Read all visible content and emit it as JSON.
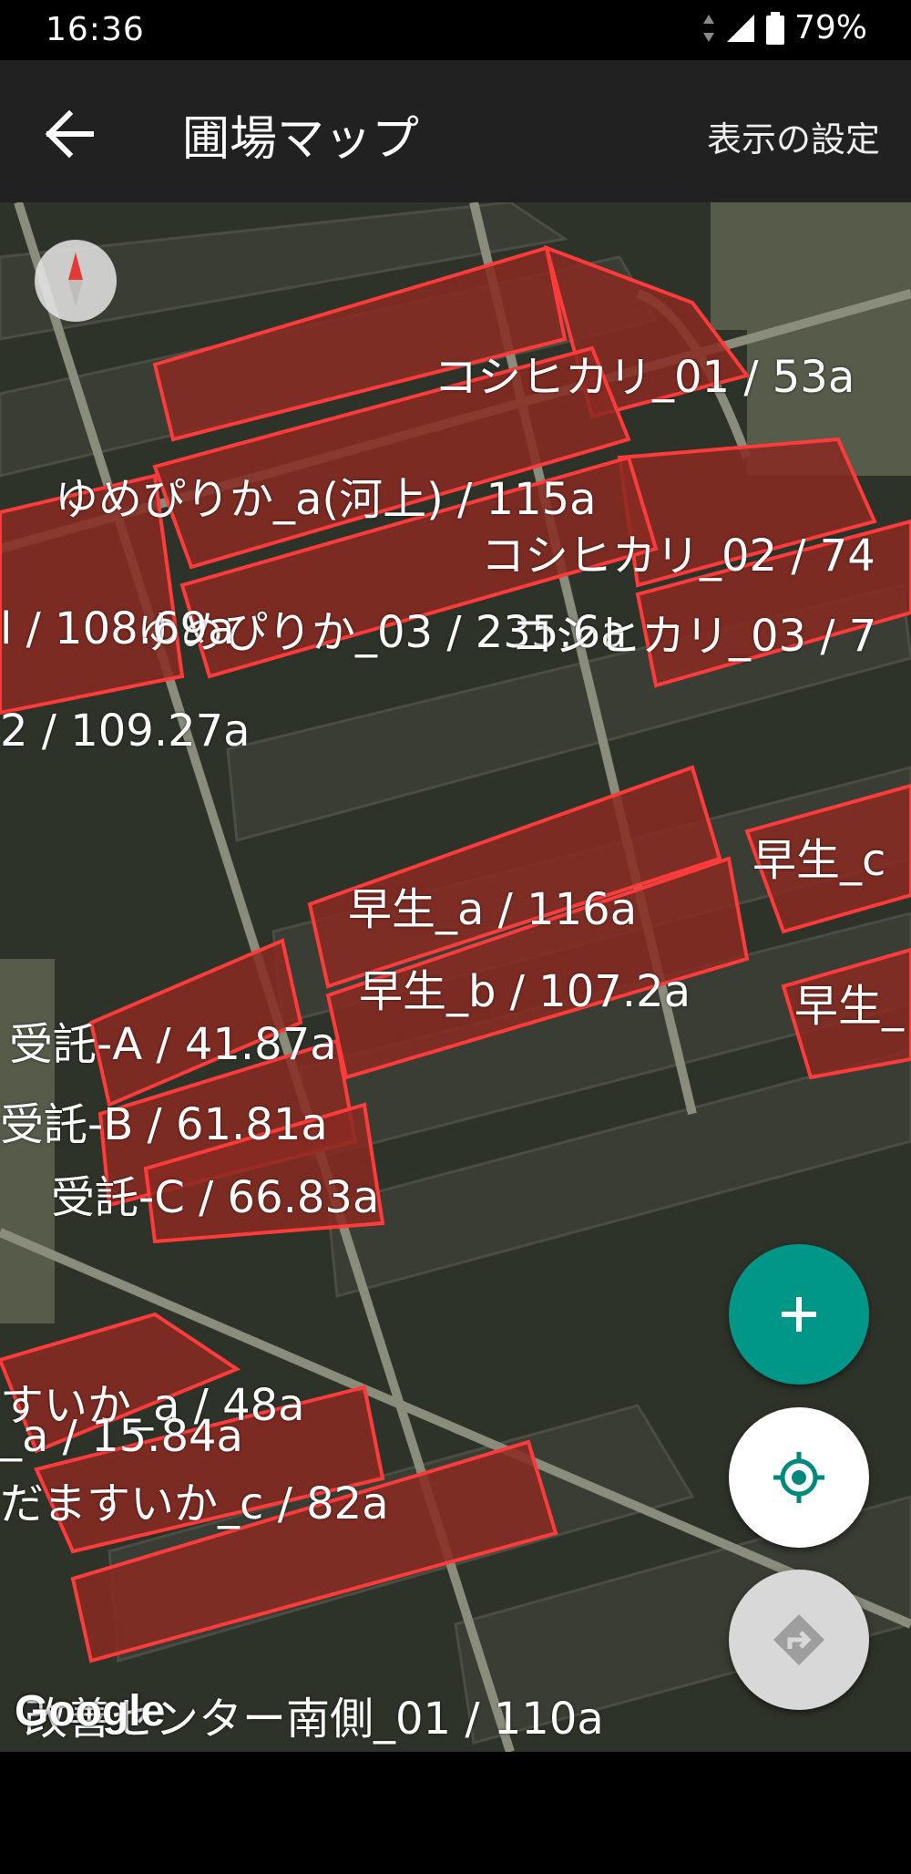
{
  "status_bar": {
    "time": "16:36",
    "battery": "79%"
  },
  "app_bar": {
    "title": "圃場マップ",
    "action": "表示の設定"
  },
  "map": {
    "attribution": "Google",
    "labels": [
      "コシヒカリ_01 / 53a",
      "ゆめぴりか_a(河上) / 115a",
      "コシヒカリ_02 / 74",
      "ゆめぴりか_03 / 235.6a",
      "コシヒカリ_03 / 7",
      "l / 108.69a",
      "2 / 109.27a",
      "早生_c",
      "早生_a / 116a",
      "早生_b / 107.2a",
      "早生_",
      "受託-A / 41.87a",
      "受託-B / 61.81a",
      "受託-C / 66.83a",
      "すいか_a / 48a",
      "_a / 15.84a",
      "だますいか_c / 82a",
      "改善センター南側_01 / 110a"
    ]
  },
  "fabs": {
    "add": "add-icon",
    "locate": "my-location-icon",
    "route": "directions-icon"
  },
  "colors": {
    "field_outline": "#ff3b3b",
    "field_fill": "#8a2a22",
    "fab_accent": "#009688"
  }
}
